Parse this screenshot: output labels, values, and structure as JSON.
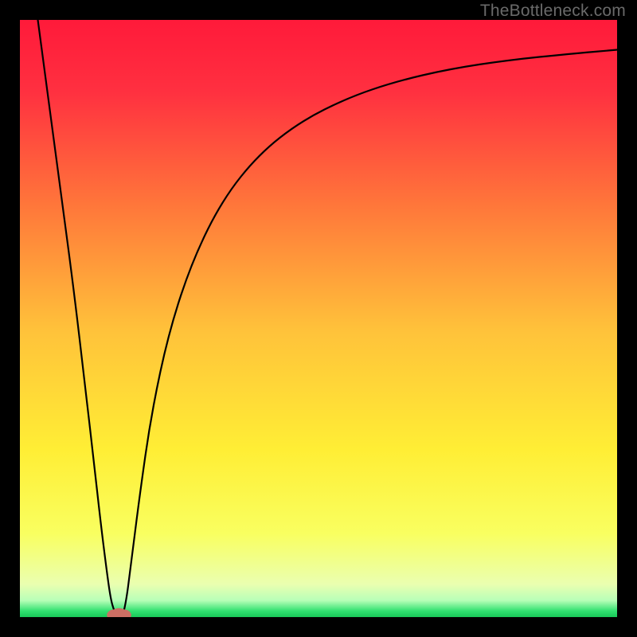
{
  "watermark": "TheBottleneck.com",
  "chart_data": {
    "type": "line",
    "title": "",
    "xlabel": "",
    "ylabel": "",
    "xlim": [
      0,
      100
    ],
    "ylim": [
      0,
      100
    ],
    "background": {
      "type": "vertical-gradient",
      "stops": [
        {
          "offset": 0.0,
          "color": "#ff1a3a"
        },
        {
          "offset": 0.12,
          "color": "#ff3040"
        },
        {
          "offset": 0.32,
          "color": "#ff7a3a"
        },
        {
          "offset": 0.52,
          "color": "#ffc23a"
        },
        {
          "offset": 0.72,
          "color": "#ffee35"
        },
        {
          "offset": 0.86,
          "color": "#f9ff60"
        },
        {
          "offset": 0.945,
          "color": "#eaffb0"
        },
        {
          "offset": 0.972,
          "color": "#b8ffb8"
        },
        {
          "offset": 0.99,
          "color": "#30e070"
        },
        {
          "offset": 1.0,
          "color": "#18c858"
        }
      ]
    },
    "series": [
      {
        "name": "left-descent",
        "x": [
          3,
          5,
          7,
          9,
          11,
          12.5,
          13.5,
          14.5,
          15.2,
          15.8,
          16.2
        ],
        "y": [
          100,
          85,
          70,
          55,
          38,
          25,
          16,
          8,
          3,
          1,
          0.2
        ]
      },
      {
        "name": "right-ascent",
        "x": [
          17.2,
          17.7,
          18.5,
          20,
          22,
          25,
          29,
          34,
          40,
          47,
          55,
          63,
          72,
          82,
          92,
          100
        ],
        "y": [
          0.2,
          2,
          8,
          20,
          34,
          48,
          60,
          70,
          77.5,
          83,
          87,
          89.7,
          91.8,
          93.3,
          94.3,
          95
        ]
      }
    ],
    "marker": {
      "name": "bottom-blob",
      "x": 16.6,
      "y": 0.4,
      "color": "#cc6f64",
      "rx": 1.7,
      "ry": 1.1
    }
  }
}
